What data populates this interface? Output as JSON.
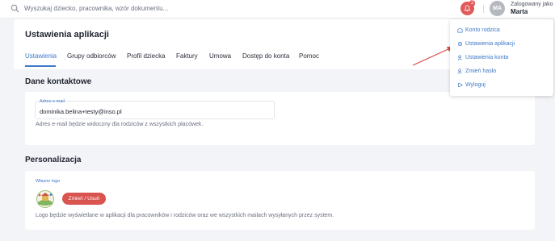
{
  "topbar": {
    "search_placeholder": "Wyszukaj dziecko, pracownika, wzór dokumentu...",
    "notification_count": "2",
    "avatar_initials": "MA",
    "logged_label": "Zalogowany jako",
    "user_name": "Marta"
  },
  "page": {
    "title": "Ustawienia aplikacji",
    "tabs": [
      "Ustawienia",
      "Grupy odbiorców",
      "Profil dziecka",
      "Faktury",
      "Umowa",
      "Dostęp do konta",
      "Pomoc"
    ],
    "active_tab": "Ustawienia"
  },
  "contact": {
    "title": "Dane kontaktowe",
    "email_label": "Adres e-mail",
    "email_value": "dominika.belina+testy@inso.pl",
    "email_help": "Adres e-mail będzie widoczny dla rodziców z wszystkich placówek."
  },
  "personalization": {
    "title": "Personalizacja",
    "logo_label": "Własne logo",
    "change_button": "Zmień / Usuń",
    "logo_help": "Logo będzie wyświetlane w aplikacji dla pracowników i rodziców oraz we wszystkich mailach wysyłanych przez system."
  },
  "dropdown": {
    "items": [
      "Konto rodzica",
      "Ustawienia aplikacji",
      "Ustawienia konta",
      "Zmień hasło",
      "Wyloguj"
    ]
  },
  "colors": {
    "accent": "#3e78c8",
    "danger": "#d9534f",
    "annotation_arrow": "#d6483f"
  }
}
